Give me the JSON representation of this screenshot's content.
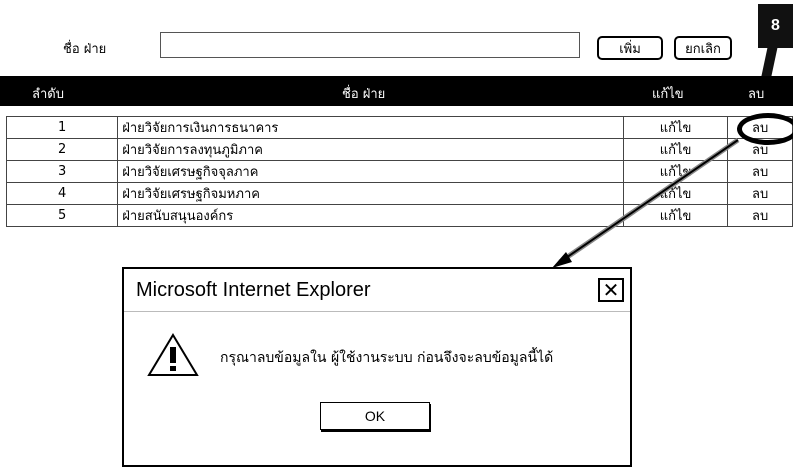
{
  "form": {
    "name_label": "ชื่อ ฝ่าย",
    "name_value": "",
    "add_label": "เพิ่ม",
    "cancel_label": "ยกเลิก"
  },
  "step_badge": "8",
  "table": {
    "headers": {
      "no": "ลำดับ",
      "name": "ชื่อ ฝ่าย",
      "edit": "แก้ไข",
      "delete": "ลบ"
    },
    "rows": [
      {
        "no": "1",
        "name": "ฝ่ายวิจัยการเงินการธนาคาร",
        "edit": "แก้ไข",
        "delete": "ลบ"
      },
      {
        "no": "2",
        "name": "ฝ่ายวิจัยการลงทุนภูมิภาค",
        "edit": "แก้ไข",
        "delete": "ลบ"
      },
      {
        "no": "3",
        "name": "ฝ่ายวิจัยเศรษฐกิจจุลภาค",
        "edit": "แก้ไข",
        "delete": "ลบ"
      },
      {
        "no": "4",
        "name": "ฝ่ายวิจัยเศรษฐกิจมหภาค",
        "edit": "แก้ไข",
        "delete": "ลบ"
      },
      {
        "no": "5",
        "name": "ฝ่ายสนับสนุนองค์กร",
        "edit": "แก้ไข",
        "delete": "ลบ"
      }
    ]
  },
  "dialog": {
    "title": "Microsoft Internet Explorer",
    "close_icon": "close-icon",
    "warning_icon": "warning-icon",
    "message": "กรุณาลบข้อมูลใน ผู้ใช้งานระบบ ก่อนจึงจะลบข้อมูลนี้ได้",
    "ok_label": "OK"
  }
}
